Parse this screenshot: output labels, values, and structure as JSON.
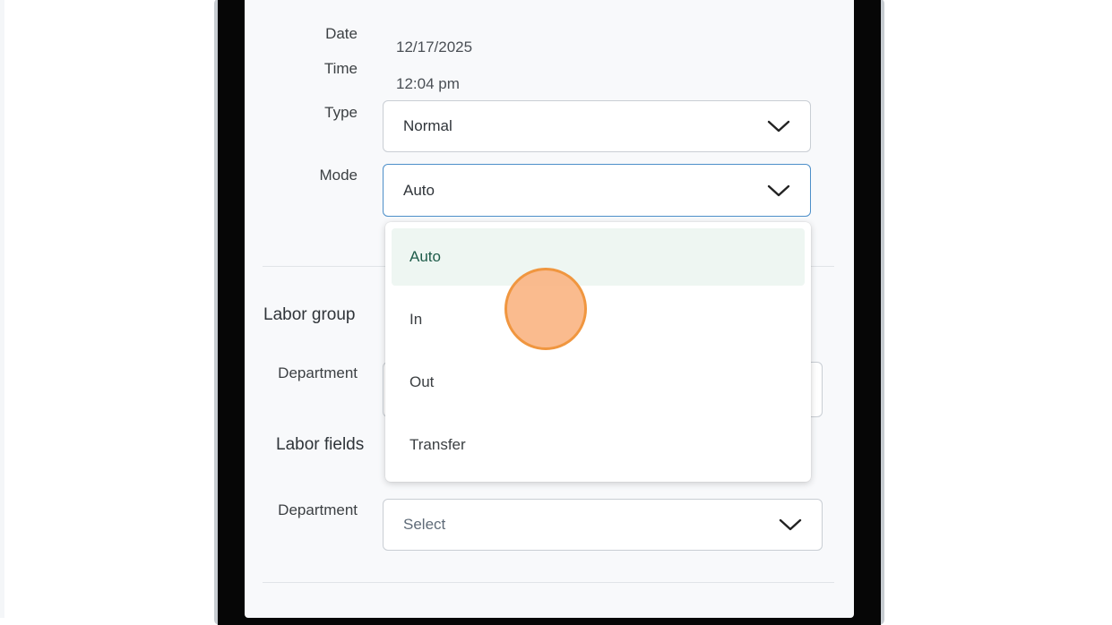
{
  "form": {
    "date_label": "Date",
    "date_value": "12/17/2025",
    "time_label": "Time",
    "time_value": "12:04 pm",
    "type_label": "Type",
    "type_value": "Normal",
    "mode_label": "Mode",
    "mode_value": "Auto"
  },
  "mode_menu": {
    "options": [
      "Auto",
      "In",
      "Out",
      "Transfer"
    ],
    "selected": "Auto"
  },
  "labor_group": {
    "title": "Labor group",
    "department_label": "Department"
  },
  "labor_fields": {
    "title": "Labor fields",
    "department_label": "Department",
    "department_placeholder": "Select"
  },
  "icons": {
    "dropdown": "chevron-down-icon"
  },
  "colors": {
    "focus_border": "#4d8fc9",
    "selected_option_bg": "#eef6f2",
    "selected_option_text": "#1f5c4a",
    "click_indicator": "#f0963f"
  }
}
